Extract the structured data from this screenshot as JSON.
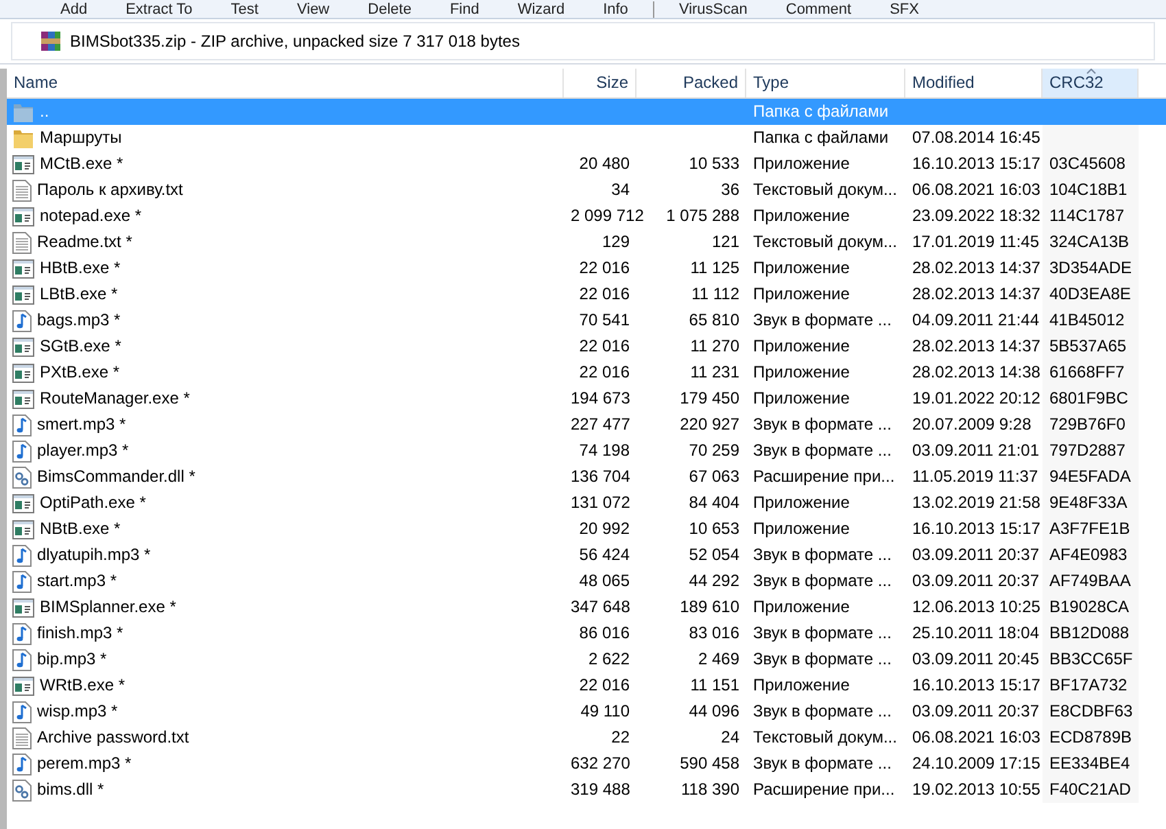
{
  "toolbar": [
    "Add",
    "Extract To",
    "Test",
    "View",
    "Delete",
    "Find",
    "Wizard",
    "Info",
    "VirusScan",
    "Comment",
    "SFX"
  ],
  "address": {
    "text": "BIMSbot335.zip - ZIP archive, unpacked size 7 317 018 bytes"
  },
  "table": {
    "columns": [
      {
        "label": "Name",
        "sorted": false
      },
      {
        "label": "Size",
        "sorted": false
      },
      {
        "label": "Packed",
        "sorted": false
      },
      {
        "label": "Type",
        "sorted": false
      },
      {
        "label": "Modified",
        "sorted": false
      },
      {
        "label": "CRC32",
        "sorted": true
      }
    ],
    "rows": [
      {
        "kind": "up",
        "name": "..",
        "type": "Папка с файлами",
        "selected": true
      },
      {
        "kind": "folder",
        "name": "Маршруты",
        "type": "Папка с файлами",
        "modified": "07.08.2014 16:45",
        "selected": false
      },
      {
        "kind": "exe",
        "name": "MCtB.exe *",
        "size": "20 480",
        "packed": "10 533",
        "type": "Приложение",
        "modified": "16.10.2013 15:17",
        "crc": "03C45608",
        "selected": false
      },
      {
        "kind": "txt",
        "name": "Пароль к архиву.txt",
        "size": "34",
        "packed": "36",
        "type": "Текстовый докум...",
        "modified": "06.08.2021 16:03",
        "crc": "104C18B1",
        "selected": false
      },
      {
        "kind": "exe",
        "name": "notepad.exe *",
        "size": "2 099 712",
        "packed": "1 075 288",
        "type": "Приложение",
        "modified": "23.09.2022 18:32",
        "crc": "114C1787",
        "selected": false
      },
      {
        "kind": "txt",
        "name": "Readme.txt *",
        "size": "129",
        "packed": "121",
        "type": "Текстовый докум...",
        "modified": "17.01.2019 11:45",
        "crc": "324CA13B",
        "selected": false
      },
      {
        "kind": "exe",
        "name": "HBtB.exe *",
        "size": "22 016",
        "packed": "11 125",
        "type": "Приложение",
        "modified": "28.02.2013 14:37",
        "crc": "3D354ADE",
        "selected": false
      },
      {
        "kind": "exe",
        "name": "LBtB.exe *",
        "size": "22 016",
        "packed": "11 112",
        "type": "Приложение",
        "modified": "28.02.2013 14:37",
        "crc": "40D3EA8E",
        "selected": false
      },
      {
        "kind": "mp3",
        "name": "bags.mp3 *",
        "size": "70 541",
        "packed": "65 810",
        "type": "Звук в формате ...",
        "modified": "04.09.2011 21:44",
        "crc": "41B45012",
        "selected": false
      },
      {
        "kind": "exe",
        "name": "SGtB.exe *",
        "size": "22 016",
        "packed": "11 270",
        "type": "Приложение",
        "modified": "28.02.2013 14:37",
        "crc": "5B537A65",
        "selected": false
      },
      {
        "kind": "exe",
        "name": "PXtB.exe *",
        "size": "22 016",
        "packed": "11 231",
        "type": "Приложение",
        "modified": "28.02.2013 14:38",
        "crc": "61668FF7",
        "selected": false
      },
      {
        "kind": "exe",
        "name": "RouteManager.exe *",
        "size": "194 673",
        "packed": "179 450",
        "type": "Приложение",
        "modified": "19.01.2022 20:12",
        "crc": "6801F9BC",
        "selected": false
      },
      {
        "kind": "mp3",
        "name": "smert.mp3 *",
        "size": "227 477",
        "packed": "220 927",
        "type": "Звук в формате ...",
        "modified": "20.07.2009 9:28",
        "crc": "729B76F0",
        "selected": false
      },
      {
        "kind": "mp3",
        "name": "player.mp3 *",
        "size": "74 198",
        "packed": "70 259",
        "type": "Звук в формате ...",
        "modified": "03.09.2011 21:01",
        "crc": "797D2887",
        "selected": false
      },
      {
        "kind": "dll",
        "name": "BimsCommander.dll *",
        "size": "136 704",
        "packed": "67 063",
        "type": "Расширение при...",
        "modified": "11.05.2019 11:37",
        "crc": "94E5FADA",
        "selected": false
      },
      {
        "kind": "exe",
        "name": "OptiPath.exe *",
        "size": "131 072",
        "packed": "84 404",
        "type": "Приложение",
        "modified": "13.02.2019 21:58",
        "crc": "9E48F33A",
        "selected": false
      },
      {
        "kind": "exe",
        "name": "NBtB.exe *",
        "size": "20 992",
        "packed": "10 653",
        "type": "Приложение",
        "modified": "16.10.2013 15:17",
        "crc": "A3F7FE1B",
        "selected": false
      },
      {
        "kind": "mp3",
        "name": "dlyatupih.mp3 *",
        "size": "56 424",
        "packed": "52 054",
        "type": "Звук в формате ...",
        "modified": "03.09.2011 20:37",
        "crc": "AF4E0983",
        "selected": false
      },
      {
        "kind": "mp3",
        "name": "start.mp3 *",
        "size": "48 065",
        "packed": "44 292",
        "type": "Звук в формате ...",
        "modified": "03.09.2011 20:37",
        "crc": "AF749BAA",
        "selected": false
      },
      {
        "kind": "exe",
        "name": "BIMSplanner.exe *",
        "size": "347 648",
        "packed": "189 610",
        "type": "Приложение",
        "modified": "12.06.2013 10:25",
        "crc": "B19028CA",
        "selected": false
      },
      {
        "kind": "mp3",
        "name": "finish.mp3 *",
        "size": "86 016",
        "packed": "83 016",
        "type": "Звук в формате ...",
        "modified": "25.10.2011 18:04",
        "crc": "BB12D088",
        "selected": false
      },
      {
        "kind": "mp3",
        "name": "bip.mp3 *",
        "size": "2 622",
        "packed": "2 469",
        "type": "Звук в формате ...",
        "modified": "03.09.2011 20:45",
        "crc": "BB3CC65F",
        "selected": false
      },
      {
        "kind": "exe",
        "name": "WRtB.exe *",
        "size": "22 016",
        "packed": "11 151",
        "type": "Приложение",
        "modified": "16.10.2013 15:17",
        "crc": "BF17A732",
        "selected": false
      },
      {
        "kind": "mp3",
        "name": "wisp.mp3 *",
        "size": "49 110",
        "packed": "44 096",
        "type": "Звук в формате ...",
        "modified": "03.09.2011 20:37",
        "crc": "E8CDBF63",
        "selected": false
      },
      {
        "kind": "txt",
        "name": "Archive password.txt",
        "size": "22",
        "packed": "24",
        "type": "Текстовый докум...",
        "modified": "06.08.2021 16:03",
        "crc": "ECD8789B",
        "selected": false
      },
      {
        "kind": "mp3",
        "name": "perem.mp3 *",
        "size": "632 270",
        "packed": "590 458",
        "type": "Звук в формате ...",
        "modified": "24.10.2009 17:15",
        "crc": "EE334BE4",
        "selected": false
      },
      {
        "kind": "dll",
        "name": "bims.dll *",
        "size": "319 488",
        "packed": "118 390",
        "type": "Расширение при...",
        "modified": "19.02.2013 10:55",
        "crc": "F40C21AD",
        "selected": false
      }
    ]
  }
}
